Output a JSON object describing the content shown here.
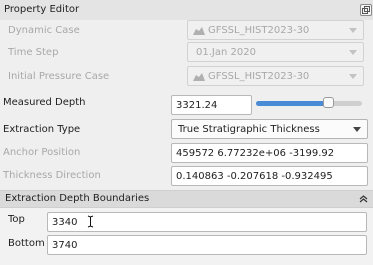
{
  "panel": {
    "title": "Property Editor",
    "float_button": "float-icon"
  },
  "dynamic_case": {
    "label": "Dynamic Case",
    "value": "GFSSL_HIST2023-30",
    "disabled": true
  },
  "time_step": {
    "label": "Time Step",
    "value": "01.Jan 2020",
    "disabled": true
  },
  "initial_pressure_case": {
    "label": "Initial Pressure Case",
    "value": "GFSSL_HIST2023-30",
    "disabled": true
  },
  "measured_depth": {
    "label": "Measured Depth",
    "value": "3321.24",
    "slider_fraction": 0.69
  },
  "extraction_type": {
    "label": "Extraction Type",
    "value": "True Stratigraphic Thickness"
  },
  "anchor_position": {
    "label": "Anchor Position",
    "value": "459572 6.77232e+06 -3199.92",
    "disabled": true
  },
  "thickness_direction": {
    "label": "Thickness Direction",
    "value": "0.140863 -0.207618 -0.932495",
    "disabled": true
  },
  "extraction_depth_boundaries": {
    "title": "Extraction Depth Boundaries",
    "top": {
      "label": "Top",
      "value": "3340"
    },
    "bottom": {
      "label": "Bottom",
      "value": "3740"
    }
  },
  "colors": {
    "accent": "#4a8bd6",
    "disabled_text": "#a8a8a8",
    "group_header": "#dadada"
  }
}
